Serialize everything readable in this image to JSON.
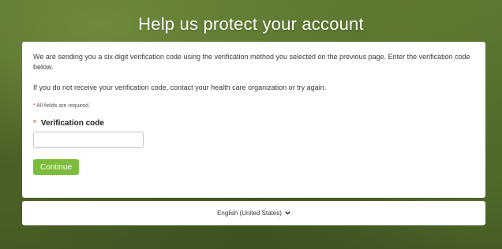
{
  "header": {
    "title": "Help us protect your account"
  },
  "form": {
    "intro": "We are sending you a six-digit verification code using the verification method you selected on the previous page. Enter the verification code below.",
    "help": "If you do not receive your verification code, contact your health care organization or try again.",
    "required_asterisk": "*",
    "required_note": "All fields are required.",
    "field_label": "Verification code",
    "field_value": "",
    "field_placeholder": "",
    "continue_label": "Continue"
  },
  "footer": {
    "language": "English (United States)",
    "language_icon": "chevron-down-icon"
  },
  "colors": {
    "accent": "#7cbc3c",
    "required": "#d32f2f",
    "background": "#4b6329"
  }
}
